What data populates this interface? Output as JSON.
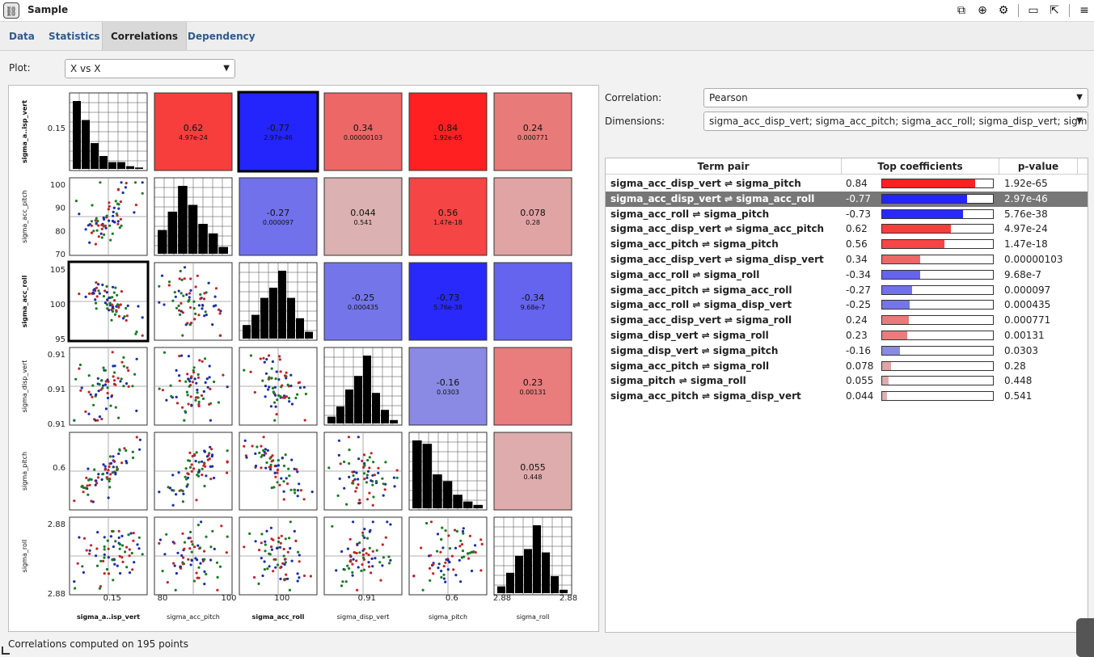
{
  "window": {
    "title": "Sample",
    "icon": "link-icon"
  },
  "toolbar": {
    "icons": [
      "copy-window-icon",
      "zoom-icon",
      "gear-icon",
      "minimize-window-icon",
      "popout-icon",
      "menu-icon"
    ]
  },
  "tabs": [
    {
      "label": "Data",
      "active": false
    },
    {
      "label": "Statistics",
      "active": false
    },
    {
      "label": "Correlations",
      "active": true
    },
    {
      "label": "Dependency",
      "active": false
    }
  ],
  "plot": {
    "label": "Plot:",
    "value": "X vs X"
  },
  "correlation": {
    "label": "Correlation:",
    "value": "Pearson"
  },
  "dimensions": {
    "label": "Dimensions:",
    "value": "sigma_acc_disp_vert; sigma_acc_pitch; sigma_acc_roll; sigma_disp_vert; sigma_..."
  },
  "matrix": {
    "variables": [
      "sigma_a..isp_vert",
      "sigma_acc_pitch",
      "sigma_acc_roll",
      "sigma_disp_vert",
      "sigma_pitch",
      "sigma_roll"
    ],
    "bold_variables": [
      0,
      2
    ],
    "cells": [
      {
        "r": 0,
        "c": 1,
        "coef": "0.62",
        "p": "4.97e-24",
        "value": 0.62
      },
      {
        "r": 0,
        "c": 2,
        "coef": "-0.77",
        "p": "2.97e-46",
        "value": -0.77
      },
      {
        "r": 0,
        "c": 3,
        "coef": "0.34",
        "p": "0.00000103",
        "value": 0.34
      },
      {
        "r": 0,
        "c": 4,
        "coef": "0.84",
        "p": "1.92e-65",
        "value": 0.84
      },
      {
        "r": 0,
        "c": 5,
        "coef": "0.24",
        "p": "0.000771",
        "value": 0.24
      },
      {
        "r": 1,
        "c": 2,
        "coef": "-0.27",
        "p": "0.000097",
        "value": -0.27
      },
      {
        "r": 1,
        "c": 3,
        "coef": "0.044",
        "p": "0.541",
        "value": 0.044
      },
      {
        "r": 1,
        "c": 4,
        "coef": "0.56",
        "p": "1.47e-18",
        "value": 0.56
      },
      {
        "r": 1,
        "c": 5,
        "coef": "0.078",
        "p": "0.28",
        "value": 0.078
      },
      {
        "r": 2,
        "c": 3,
        "coef": "-0.25",
        "p": "0.000435",
        "value": -0.25
      },
      {
        "r": 2,
        "c": 4,
        "coef": "-0.73",
        "p": "5.76e-38",
        "value": -0.73
      },
      {
        "r": 2,
        "c": 5,
        "coef": "-0.34",
        "p": "9.68e-7",
        "value": -0.34
      },
      {
        "r": 3,
        "c": 4,
        "coef": "-0.16",
        "p": "0.0303",
        "value": -0.16
      },
      {
        "r": 3,
        "c": 5,
        "coef": "0.23",
        "p": "0.00131",
        "value": 0.23
      },
      {
        "r": 4,
        "c": 5,
        "coef": "0.055",
        "p": "0.448",
        "value": 0.055
      }
    ],
    "histograms": [
      [
        1.0,
        0.72,
        0.38,
        0.19,
        0.1,
        0.1,
        0.04,
        0.02
      ],
      [
        0.35,
        0.62,
        1.0,
        0.72,
        0.44,
        0.3,
        0.1
      ],
      [
        0.2,
        0.35,
        0.6,
        0.75,
        1.0,
        0.6,
        0.3,
        0.1
      ],
      [
        0.1,
        0.25,
        0.5,
        0.7,
        1.0,
        0.45,
        0.2,
        0.05
      ],
      [
        1.0,
        0.95,
        0.5,
        0.4,
        0.2,
        0.1,
        0.05
      ],
      [
        0.1,
        0.3,
        0.55,
        0.65,
        1.0,
        0.6,
        0.25,
        0.05
      ]
    ],
    "left_ticks": [
      [
        "0.15"
      ],
      [
        "100",
        "90",
        "80",
        "70"
      ],
      [
        "105",
        "100",
        "95"
      ],
      [
        "0.91",
        "0.91",
        "0.91"
      ],
      [
        "0.6"
      ],
      [
        "2.88",
        "2.88"
      ]
    ],
    "bottom_ticks": [
      [
        "0.15"
      ],
      [
        "80",
        "100"
      ],
      [
        "100"
      ],
      [
        "0.91"
      ],
      [
        "0.6"
      ],
      [
        "2.88",
        "2.88"
      ]
    ],
    "scatter_trend": [
      [
        null,
        0.62,
        -0.77,
        0.34,
        0.84,
        0.24
      ],
      [
        0.62,
        null,
        -0.27,
        0.044,
        0.56,
        0.078
      ],
      [
        -0.77,
        -0.27,
        null,
        -0.25,
        -0.73,
        -0.34
      ],
      [
        0.34,
        0.044,
        -0.25,
        null,
        -0.16,
        0.23
      ],
      [
        0.84,
        0.56,
        -0.73,
        -0.16,
        null,
        0.055
      ],
      [
        0.24,
        0.078,
        -0.34,
        0.23,
        0.055,
        null
      ]
    ],
    "point_colors": [
      "#1a2fa6",
      "#c0262a",
      "#1d7a26"
    ]
  },
  "table": {
    "headers": [
      "Term pair",
      "Top coefficients",
      "p-value"
    ],
    "rows": [
      {
        "pair": "sigma_acc_disp_vert ⇌ sigma_pitch",
        "coef": "0.84",
        "value": 0.84,
        "p": "1.92e-65",
        "selected": false
      },
      {
        "pair": "sigma_acc_disp_vert ⇌ sigma_acc_roll",
        "coef": "-0.77",
        "value": -0.77,
        "p": "2.97e-46",
        "selected": true
      },
      {
        "pair": "sigma_acc_roll ⇌ sigma_pitch",
        "coef": "-0.73",
        "value": -0.73,
        "p": "5.76e-38",
        "selected": false
      },
      {
        "pair": "sigma_acc_disp_vert ⇌ sigma_acc_pitch",
        "coef": "0.62",
        "value": 0.62,
        "p": "4.97e-24",
        "selected": false
      },
      {
        "pair": "sigma_acc_pitch ⇌ sigma_pitch",
        "coef": "0.56",
        "value": 0.56,
        "p": "1.47e-18",
        "selected": false
      },
      {
        "pair": "sigma_acc_disp_vert ⇌ sigma_disp_vert",
        "coef": "0.34",
        "value": 0.34,
        "p": "0.00000103",
        "selected": false
      },
      {
        "pair": "sigma_acc_roll ⇌ sigma_roll",
        "coef": "-0.34",
        "value": -0.34,
        "p": "9.68e-7",
        "selected": false
      },
      {
        "pair": "sigma_acc_pitch ⇌ sigma_acc_roll",
        "coef": "-0.27",
        "value": -0.27,
        "p": "0.000097",
        "selected": false
      },
      {
        "pair": "sigma_acc_roll ⇌ sigma_disp_vert",
        "coef": "-0.25",
        "value": -0.25,
        "p": "0.000435",
        "selected": false
      },
      {
        "pair": "sigma_acc_disp_vert ⇌ sigma_roll",
        "coef": "0.24",
        "value": 0.24,
        "p": "0.000771",
        "selected": false
      },
      {
        "pair": "sigma_disp_vert ⇌ sigma_roll",
        "coef": "0.23",
        "value": 0.23,
        "p": "0.00131",
        "selected": false
      },
      {
        "pair": "sigma_disp_vert ⇌ sigma_pitch",
        "coef": "-0.16",
        "value": -0.16,
        "p": "0.0303",
        "selected": false
      },
      {
        "pair": "sigma_acc_pitch ⇌ sigma_roll",
        "coef": "0.078",
        "value": 0.078,
        "p": "0.28",
        "selected": false
      },
      {
        "pair": "sigma_pitch ⇌ sigma_roll",
        "coef": "0.055",
        "value": 0.055,
        "p": "0.448",
        "selected": false
      },
      {
        "pair": "sigma_acc_pitch ⇌ sigma_disp_vert",
        "coef": "0.044",
        "value": 0.044,
        "p": "0.541",
        "selected": false
      }
    ]
  },
  "status": "Correlations computed on 195 points",
  "colors": {
    "positive": "#ff2020",
    "negative": "#1a1aff",
    "neutral": "#d4d4d4",
    "tab_link": "#2f5b8a"
  }
}
